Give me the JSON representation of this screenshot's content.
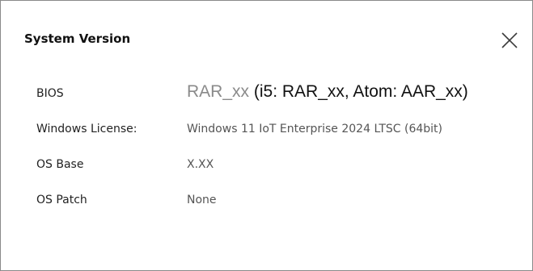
{
  "dialog": {
    "title": "System Version",
    "close_icon": "close-icon"
  },
  "rows": {
    "bios": {
      "label": "BIOS",
      "value": "RAR_xx",
      "extra": "(i5: RAR_xx, Atom: AAR_xx)"
    },
    "license": {
      "label": "Windows License:",
      "value": "Windows 11 IoT Enterprise 2024 LTSC (64bit)"
    },
    "os_base": {
      "label": "OS Base",
      "value": "X.XX"
    },
    "os_patch": {
      "label": "OS Patch",
      "value": "None"
    }
  },
  "colors": {
    "text_dark": "#111111",
    "text_value": "#555555",
    "text_muted": "#8a8a8a",
    "border": "#8a8a8a"
  }
}
